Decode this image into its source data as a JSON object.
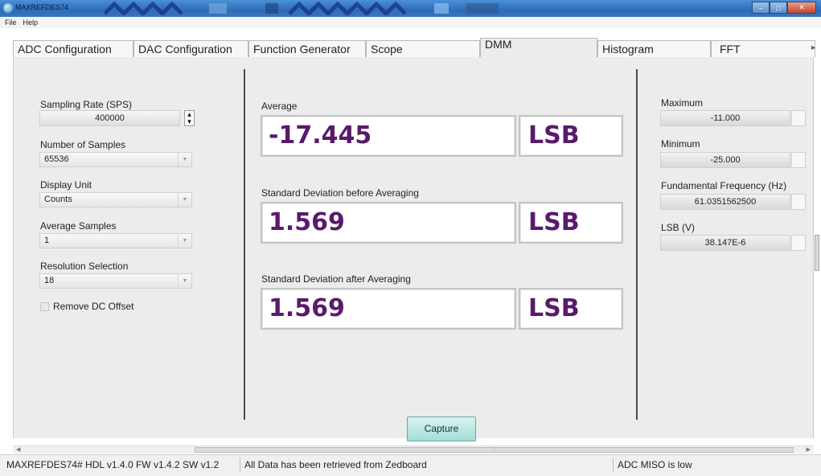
{
  "window": {
    "title": "MAXREFDES74"
  },
  "menu": {
    "items": [
      "File",
      "Help"
    ]
  },
  "tabs": [
    {
      "label": "ADC Configuration"
    },
    {
      "label": "DAC Configuration"
    },
    {
      "label": "Function Generator"
    },
    {
      "label": "Scope"
    },
    {
      "label": "DMM",
      "active": true
    },
    {
      "label": "Histogram"
    },
    {
      "label": "FFT"
    }
  ],
  "left": {
    "sampling_rate_label": "Sampling Rate (SPS)",
    "sampling_rate_value": "400000",
    "num_samples_label": "Number of Samples",
    "num_samples_value": "65536",
    "display_unit_label": "Display Unit",
    "display_unit_value": "Counts",
    "avg_samples_label": "Average Samples",
    "avg_samples_value": "1",
    "resolution_label": "Resolution Selection",
    "resolution_value": "18",
    "remove_dc_label": "Remove DC Offset",
    "remove_dc_checked": false
  },
  "center": {
    "average_label": "Average",
    "average_value": "-17.445",
    "average_unit": "LSB",
    "std_before_label": "Standard Deviation before Averaging",
    "std_before_value": "1.569",
    "std_before_unit": "LSB",
    "std_after_label": "Standard Deviation after Averaging",
    "std_after_value": "1.569",
    "std_after_unit": "LSB",
    "capture_label": "Capture"
  },
  "right": {
    "max_label": "Maximum",
    "max_value": "-11.000",
    "min_label": "Minimum",
    "min_value": "-25.000",
    "fund_label": "Fundamental Frequency (Hz)",
    "fund_value": "61.0351562500",
    "lsb_label": "LSB (V)",
    "lsb_value": "38.147E-6"
  },
  "status": {
    "version": "MAXREFDES74# HDL v1.4.0 FW v1.4.2 SW v1.2",
    "message": "All Data has been retrieved from Zedboard",
    "miso": "ADC MISO is low"
  },
  "colors": {
    "value_text": "#5a1a6b",
    "capture_button": "#a4ddd7",
    "titlebar": "#3774bd"
  }
}
